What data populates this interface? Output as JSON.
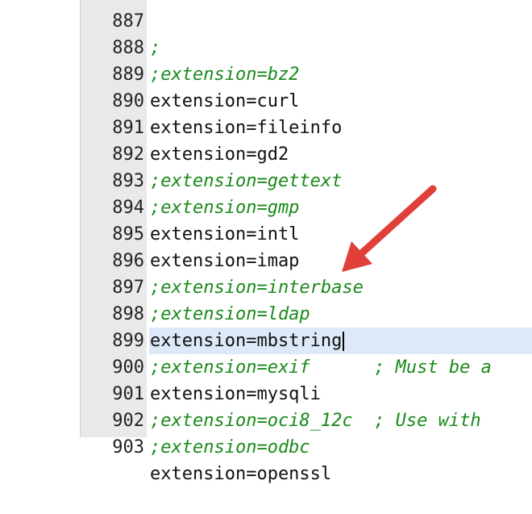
{
  "editor": {
    "lines": [
      {
        "num": "887",
        "text": ";",
        "comment": true
      },
      {
        "num": "888",
        "text": ";extension=bz2",
        "comment": true
      },
      {
        "num": "889",
        "text": "extension=curl",
        "comment": false
      },
      {
        "num": "890",
        "text": "extension=fileinfo",
        "comment": false
      },
      {
        "num": "891",
        "text": "extension=gd2",
        "comment": false
      },
      {
        "num": "892",
        "text": ";extension=gettext",
        "comment": true
      },
      {
        "num": "893",
        "text": ";extension=gmp",
        "comment": true
      },
      {
        "num": "894",
        "text": "extension=intl",
        "comment": false
      },
      {
        "num": "895",
        "text": "extension=imap",
        "comment": false
      },
      {
        "num": "896",
        "text": ";extension=interbase",
        "comment": true
      },
      {
        "num": "897",
        "text": ";extension=ldap",
        "comment": true
      },
      {
        "num": "898",
        "text": "extension=mbstring",
        "comment": false,
        "current": true
      },
      {
        "num": "899",
        "text": ";extension=exif      ; Must be a",
        "comment": true
      },
      {
        "num": "900",
        "text": "extension=mysqli",
        "comment": false
      },
      {
        "num": "901",
        "text": ";extension=oci8_12c  ; Use with",
        "comment": true
      },
      {
        "num": "902",
        "text": ";extension=odbc",
        "comment": true
      },
      {
        "num": "903",
        "text": "extension=openssl",
        "comment": false
      }
    ]
  },
  "colors": {
    "comment": "#1a8a1a",
    "current_line": "#dde9f8",
    "gutter": "#e9e9e9",
    "arrow": "#e0403a"
  }
}
